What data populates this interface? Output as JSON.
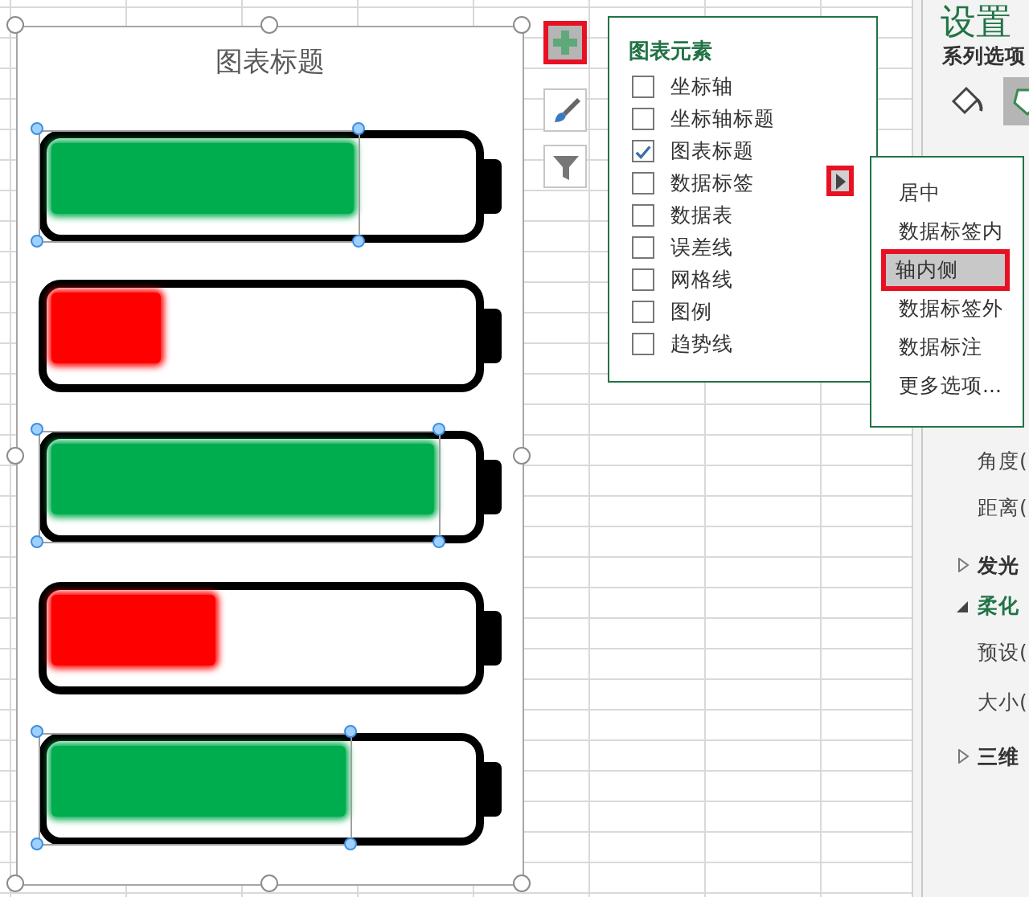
{
  "chart": {
    "title": "图表标题",
    "batteries": [
      {
        "level": 0.72,
        "color": "#00ad4e",
        "selected": true
      },
      {
        "level": 0.26,
        "color": "#ff0000",
        "selected": false
      },
      {
        "level": 0.91,
        "color": "#00ad4e",
        "selected": true
      },
      {
        "level": 0.39,
        "color": "#ff0000",
        "selected": false
      },
      {
        "level": 0.7,
        "color": "#00ad4e",
        "selected": true
      }
    ]
  },
  "chart_buttons": [
    {
      "kind": "add",
      "highlighted": true
    },
    {
      "kind": "style",
      "highlighted": false
    },
    {
      "kind": "filter",
      "highlighted": false
    }
  ],
  "chart_elements": {
    "title": "图表元素",
    "items": [
      {
        "label": "坐标轴",
        "checked": false
      },
      {
        "label": "坐标轴标题",
        "checked": false
      },
      {
        "label": "图表标题",
        "checked": true
      },
      {
        "label": "数据标签",
        "checked": false,
        "submenu_arrow": {
          "highlighted": true
        }
      },
      {
        "label": "数据表",
        "checked": false
      },
      {
        "label": "误差线",
        "checked": false
      },
      {
        "label": "网格线",
        "checked": false
      },
      {
        "label": "图例",
        "checked": false
      },
      {
        "label": "趋势线",
        "checked": false
      }
    ]
  },
  "submenu": {
    "items": [
      {
        "label": "居中",
        "selected": false
      },
      {
        "label": "数据标签内",
        "selected": false
      },
      {
        "label": "轴内侧",
        "selected": true
      },
      {
        "label": "数据标签外",
        "selected": false
      },
      {
        "label": "数据标注",
        "selected": false
      },
      {
        "label": "更多选项...",
        "selected": false
      }
    ]
  },
  "format_pane": {
    "title": "设置",
    "subtitle": "系列选项",
    "tabs": [
      {
        "kind": "fill",
        "selected": false
      },
      {
        "kind": "effects",
        "selected": true
      }
    ],
    "rows": [
      {
        "kind": "field",
        "label": "角度("
      },
      {
        "kind": "field",
        "label": "距离("
      },
      {
        "kind": "section",
        "label": "发光",
        "expanded": false
      },
      {
        "kind": "section",
        "label": "柔化",
        "expanded": true
      },
      {
        "kind": "field",
        "label": "预设("
      },
      {
        "kind": "field",
        "label": "大小("
      },
      {
        "kind": "section",
        "label": "三维",
        "expanded": false
      }
    ]
  }
}
